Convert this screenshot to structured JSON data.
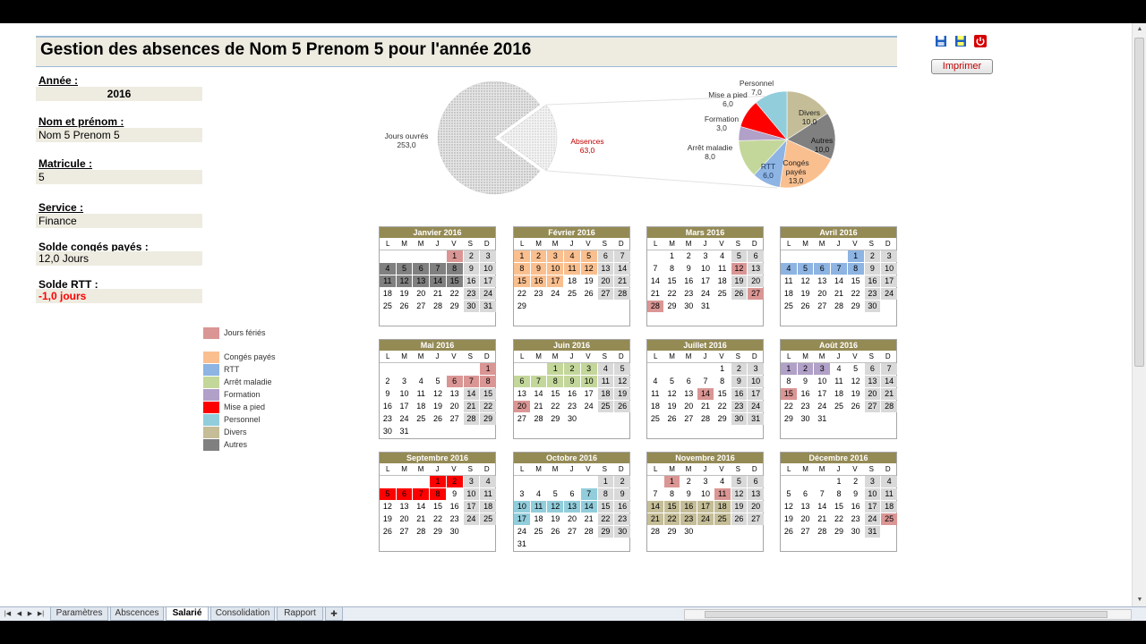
{
  "title": "Gestion des absences de Nom 5 Prenom 5 pour l'année 2016",
  "toolbar": {
    "print_label": "Imprimer"
  },
  "fields": [
    {
      "label": "Année :",
      "value": "2016"
    },
    {
      "label": "Nom et prénom :",
      "value": "Nom 5 Prenom 5"
    },
    {
      "label": "Matricule :",
      "value": "5"
    },
    {
      "label": "Service :",
      "value": "Finance"
    },
    {
      "label": "Solde congés payés :",
      "value": "12,0 Jours"
    },
    {
      "label": "Solde RTT :",
      "value": "-1,0 jours"
    }
  ],
  "legend": [
    {
      "key": "ferie",
      "label": "Jours fériés",
      "color": "#da9694"
    },
    {
      "key": "cp",
      "label": "Congés payés",
      "color": "#fabf8f"
    },
    {
      "key": "rtt",
      "label": "RTT",
      "color": "#8db4e2"
    },
    {
      "key": "mal",
      "label": "Arrêt maladie",
      "color": "#c4d79b"
    },
    {
      "key": "form",
      "label": "Formation",
      "color": "#b1a0c7"
    },
    {
      "key": "map",
      "label": "Mise a pied",
      "color": "#ff0000"
    },
    {
      "key": "pers",
      "label": "Personnel",
      "color": "#92cddc"
    },
    {
      "key": "div",
      "label": "Divers",
      "color": "#c4bd97"
    },
    {
      "key": "aut",
      "label": "Autres",
      "color": "#808080"
    }
  ],
  "weekdays": [
    "L",
    "M",
    "M",
    "J",
    "V",
    "S",
    "D"
  ],
  "chart_data": [
    {
      "type": "pie",
      "title": "",
      "slices": [
        {
          "label": "Jours ouvrés",
          "value": "253,0",
          "num": 253,
          "color": "#d9d9d9"
        },
        {
          "label": "Absences",
          "value": "63,0",
          "num": 63,
          "color": "#eeeeee"
        }
      ]
    },
    {
      "type": "pie",
      "title": "",
      "slices": [
        {
          "label": "Divers",
          "value": "10,0",
          "num": 10,
          "color": "#c4bd97"
        },
        {
          "label": "Autres",
          "value": "10,0",
          "num": 10,
          "color": "#808080"
        },
        {
          "label": "Congés payés",
          "value": "13,0",
          "num": 13,
          "color": "#fabf8f"
        },
        {
          "label": "RTT",
          "value": "6,0",
          "num": 6,
          "color": "#8db4e2"
        },
        {
          "label": "Arrêt maladie",
          "value": "8,0",
          "num": 8,
          "color": "#c4d79b"
        },
        {
          "label": "Formation",
          "value": "3,0",
          "num": 3,
          "color": "#b1a0c7"
        },
        {
          "label": "Mise a pied",
          "value": "6,0",
          "num": 6,
          "color": "#ff0000"
        },
        {
          "label": "Personnel",
          "value": "7,0",
          "num": 7,
          "color": "#92cddc"
        }
      ]
    }
  ],
  "months": [
    {
      "name": "Janvier 2016",
      "offset": 4,
      "days": 31,
      "marks": {
        "ferie": [
          1
        ],
        "aut": [
          4,
          5,
          6,
          7,
          8,
          11,
          12,
          13,
          14,
          15
        ]
      }
    },
    {
      "name": "Février 2016",
      "offset": 0,
      "days": 29,
      "marks": {
        "cp": [
          1,
          2,
          3,
          4,
          5,
          8,
          9,
          10,
          11,
          12,
          15,
          16,
          17
        ]
      }
    },
    {
      "name": "Mars 2016",
      "offset": 1,
      "days": 31,
      "marks": {
        "ferie": [
          12,
          27,
          28
        ]
      }
    },
    {
      "name": "Avril 2016",
      "offset": 4,
      "days": 30,
      "marks": {
        "rtt": [
          1,
          4,
          5,
          6,
          7,
          8
        ]
      }
    },
    {
      "name": "Mai 2016",
      "offset": 6,
      "days": 31,
      "marks": {
        "ferie": [
          1,
          6,
          7,
          8
        ]
      }
    },
    {
      "name": "Juin 2016",
      "offset": 2,
      "days": 30,
      "marks": {
        "mal": [
          1,
          2,
          3,
          6,
          7,
          8,
          9,
          10
        ],
        "ferie": [
          20
        ]
      }
    },
    {
      "name": "Juillet 2016",
      "offset": 4,
      "days": 31,
      "marks": {
        "ferie": [
          14
        ]
      }
    },
    {
      "name": "Août 2016",
      "offset": 0,
      "days": 31,
      "marks": {
        "form": [
          1,
          2,
          3
        ],
        "ferie": [
          15
        ]
      }
    },
    {
      "name": "Septembre 2016",
      "offset": 3,
      "days": 30,
      "marks": {
        "map": [
          1,
          2,
          5,
          6,
          7,
          8
        ]
      }
    },
    {
      "name": "Octobre 2016",
      "offset": 5,
      "days": 31,
      "marks": {
        "pers": [
          7,
          10,
          11,
          12,
          13,
          14,
          17
        ]
      }
    },
    {
      "name": "Novembre 2016",
      "offset": 1,
      "days": 30,
      "marks": {
        "ferie": [
          1,
          11
        ],
        "div": [
          14,
          15,
          16,
          17,
          18,
          21,
          22,
          23,
          24,
          25
        ]
      }
    },
    {
      "name": "Décembre 2016",
      "offset": 3,
      "days": 31,
      "marks": {
        "ferie": [
          25
        ]
      }
    }
  ],
  "sheet_tabs": [
    "Paramètres",
    "Abscences",
    "Salarié",
    "Consolidation",
    "Rapport"
  ],
  "active_tab": "Salarié"
}
